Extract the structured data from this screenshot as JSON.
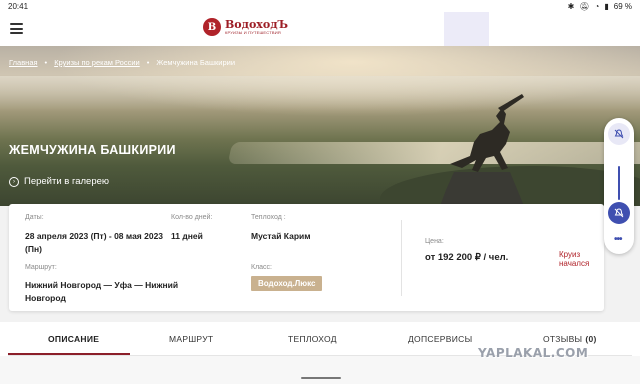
{
  "status": {
    "time": "20:41",
    "battery": "69 %"
  },
  "header": {
    "logo_mark": "В",
    "logo_name": "ВодоходЪ",
    "logo_sub": "КРУИЗЫ И ПУТЕШЕСТВИЯ"
  },
  "breadcrumb": {
    "items": [
      "Главная",
      "Круизы по рекам России",
      "Жемчужина Башкирии"
    ],
    "separator": "•"
  },
  "hero": {
    "title": "ЖЕМЧУЖИНА БАШКИРИИ",
    "gallery_link": "Перейти в галерею"
  },
  "card": {
    "dates_label": "Даты:",
    "dates_value": "28 апреля 2023 (Пт) - 08 мая 2023 (Пн)",
    "days_label": "Кол-во дней:",
    "days_value": "11 дней",
    "ship_label": "Теплоход :",
    "ship_value": "Мустай Карим",
    "route_label": "Маршрут:",
    "route_value": "Нижний Новгород — Уфа — Нижний Новгород",
    "class_label": "Класс:",
    "class_value": "Водоход.Люкс",
    "price_label": "Цена:",
    "price_value": "от 192 200 ₽ / чел.",
    "cruise_status": "Круиз начался"
  },
  "tabs": [
    {
      "label": "ОПИСАНИЕ"
    },
    {
      "label": "МАРШРУТ"
    },
    {
      "label": "ТЕПЛОХОД"
    },
    {
      "label": "ДОПСЕРВИСЫ"
    },
    {
      "label": "ОТЗЫВЫ",
      "badge": "(0)"
    }
  ],
  "active_tab": "ОПИСАНИЕ",
  "watermark": "YAPLAKAL.COM",
  "colors": {
    "brand": "#9d1d25",
    "accent": "#3f4fb0",
    "class_badge": "#c9b18f"
  }
}
